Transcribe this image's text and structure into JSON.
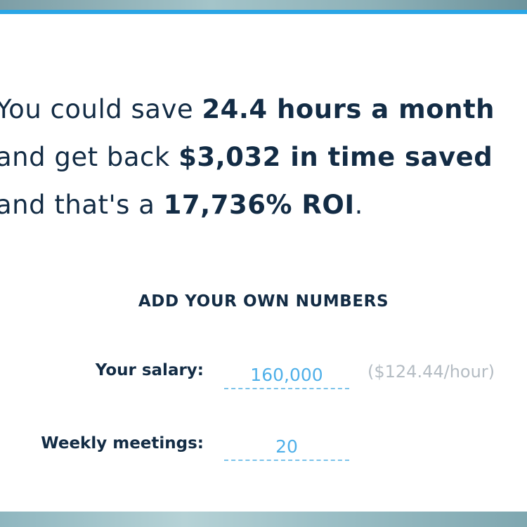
{
  "colors": {
    "accent": "#2aa6e6",
    "heading": "#132c45",
    "input_text": "#4fb0e9",
    "hint": "#b4bcc3"
  },
  "headline": {
    "line1_prefix": "You could save ",
    "line1_bold": "24.4 hours a month",
    "line2_prefix": "and get back ",
    "line2_bold": "$3,032 in time saved",
    "line3_prefix": "and that's a ",
    "line3_bold": "17,736% ROI",
    "line3_suffix": "."
  },
  "calculator": {
    "section_title": "ADD YOUR OWN NUMBERS",
    "salary": {
      "label": "Your salary:",
      "value": "160,000",
      "hourly_hint": "($124.44/hour)"
    },
    "meetings": {
      "label": "Weekly meetings:",
      "value": "20"
    }
  }
}
